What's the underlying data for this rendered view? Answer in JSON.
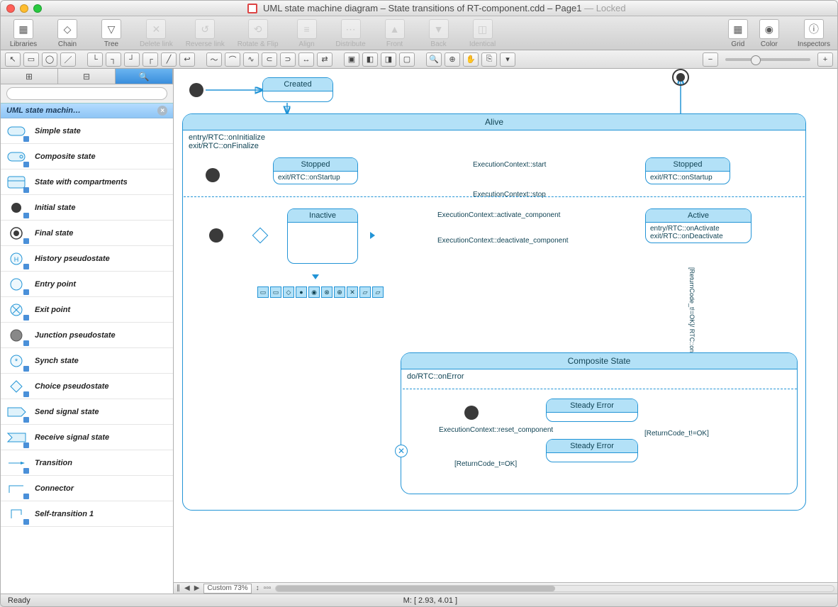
{
  "window": {
    "title": "UML state machine diagram – State transitions of RT-component.cdd – Page1",
    "locked": "— Locked"
  },
  "toolbar": [
    {
      "label": "Libraries",
      "icon": "▦",
      "disabled": false
    },
    {
      "label": "Chain",
      "icon": "◇",
      "disabled": false
    },
    {
      "label": "Tree",
      "icon": "▽",
      "disabled": false
    },
    {
      "label": "Delete link",
      "icon": "✕",
      "disabled": true
    },
    {
      "label": "Reverse link",
      "icon": "↺",
      "disabled": true
    },
    {
      "label": "Rotate & Flip",
      "icon": "⟲",
      "disabled": true
    },
    {
      "label": "Align",
      "icon": "≡",
      "disabled": true
    },
    {
      "label": "Distribute",
      "icon": "⋯",
      "disabled": true
    },
    {
      "label": "Front",
      "icon": "▲",
      "disabled": true
    },
    {
      "label": "Back",
      "icon": "▼",
      "disabled": true
    },
    {
      "label": "Identical",
      "icon": "◫",
      "disabled": true
    },
    {
      "label": "Grid",
      "icon": "▦",
      "disabled": false
    },
    {
      "label": "Color",
      "icon": "◉",
      "disabled": false
    },
    {
      "label": "Inspectors",
      "icon": "ⓘ",
      "disabled": false
    }
  ],
  "sidebar": {
    "library_title": "UML state machin…",
    "search_placeholder": "",
    "shapes": [
      {
        "label": "Simple state"
      },
      {
        "label": "Composite state"
      },
      {
        "label": "State with compartments"
      },
      {
        "label": "Initial state"
      },
      {
        "label": "Final state"
      },
      {
        "label": "History pseudostate"
      },
      {
        "label": "Entry point"
      },
      {
        "label": "Exit point"
      },
      {
        "label": "Junction pseudostate"
      },
      {
        "label": "Synch state"
      },
      {
        "label": "Choice pseudostate"
      },
      {
        "label": "Send signal state"
      },
      {
        "label": "Receive signal state"
      },
      {
        "label": "Transition"
      },
      {
        "label": "Connector"
      },
      {
        "label": "Self-transition 1"
      }
    ]
  },
  "diagram": {
    "created": "Created",
    "alive": "Alive",
    "alive_entry": "entry/RTC::onInitialize",
    "alive_exit": "exit/RTC::onFinalize",
    "stopped1": "Stopped",
    "stopped1_body": "exit/RTC::onStartup",
    "stopped2": "Stopped",
    "stopped2_body": "exit/RTC::onStartup",
    "inactive": "Inactive",
    "active": "Active",
    "active_entry": "entry/RTC::onActivate",
    "active_exit": "exit/RTC::onDeactivate",
    "comp": "Composite State",
    "comp_body": "do/RTC::onError",
    "steady1": "Steady Error",
    "steady2": "Steady Error",
    "t_start": "ExecutionContext::start",
    "t_stop": "ExecutionContext::stop",
    "t_activate": "ExecutionContext::activate_component",
    "t_deactivate": "ExecutionContext::deactivate_component",
    "t_reset": "ExecutionContext::reset_component",
    "t_rc_ok": "[ReturnCode_t=OK]",
    "t_rc_nok_abort": "[ReturnCode_t!=OK]/\nRTC::onAborting",
    "t_rc_nok": "[ReturnCode_t!=OK]"
  },
  "footer": {
    "zoom": "Custom 73%",
    "status": "Ready",
    "mouse": "M: [ 2.93, 4.01 ]"
  }
}
